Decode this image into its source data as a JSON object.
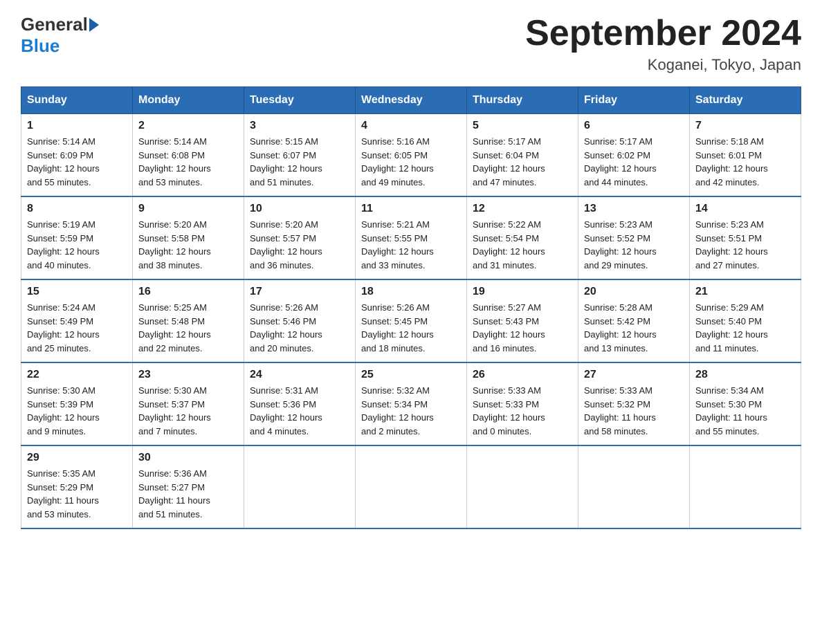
{
  "header": {
    "logo_general": "General",
    "logo_blue": "Blue",
    "title": "September 2024",
    "subtitle": "Koganei, Tokyo, Japan"
  },
  "days_of_week": [
    "Sunday",
    "Monday",
    "Tuesday",
    "Wednesday",
    "Thursday",
    "Friday",
    "Saturday"
  ],
  "weeks": [
    [
      {
        "day": "1",
        "sunrise": "5:14 AM",
        "sunset": "6:09 PM",
        "daylight": "12 hours and 55 minutes."
      },
      {
        "day": "2",
        "sunrise": "5:14 AM",
        "sunset": "6:08 PM",
        "daylight": "12 hours and 53 minutes."
      },
      {
        "day": "3",
        "sunrise": "5:15 AM",
        "sunset": "6:07 PM",
        "daylight": "12 hours and 51 minutes."
      },
      {
        "day": "4",
        "sunrise": "5:16 AM",
        "sunset": "6:05 PM",
        "daylight": "12 hours and 49 minutes."
      },
      {
        "day": "5",
        "sunrise": "5:17 AM",
        "sunset": "6:04 PM",
        "daylight": "12 hours and 47 minutes."
      },
      {
        "day": "6",
        "sunrise": "5:17 AM",
        "sunset": "6:02 PM",
        "daylight": "12 hours and 44 minutes."
      },
      {
        "day": "7",
        "sunrise": "5:18 AM",
        "sunset": "6:01 PM",
        "daylight": "12 hours and 42 minutes."
      }
    ],
    [
      {
        "day": "8",
        "sunrise": "5:19 AM",
        "sunset": "5:59 PM",
        "daylight": "12 hours and 40 minutes."
      },
      {
        "day": "9",
        "sunrise": "5:20 AM",
        "sunset": "5:58 PM",
        "daylight": "12 hours and 38 minutes."
      },
      {
        "day": "10",
        "sunrise": "5:20 AM",
        "sunset": "5:57 PM",
        "daylight": "12 hours and 36 minutes."
      },
      {
        "day": "11",
        "sunrise": "5:21 AM",
        "sunset": "5:55 PM",
        "daylight": "12 hours and 33 minutes."
      },
      {
        "day": "12",
        "sunrise": "5:22 AM",
        "sunset": "5:54 PM",
        "daylight": "12 hours and 31 minutes."
      },
      {
        "day": "13",
        "sunrise": "5:23 AM",
        "sunset": "5:52 PM",
        "daylight": "12 hours and 29 minutes."
      },
      {
        "day": "14",
        "sunrise": "5:23 AM",
        "sunset": "5:51 PM",
        "daylight": "12 hours and 27 minutes."
      }
    ],
    [
      {
        "day": "15",
        "sunrise": "5:24 AM",
        "sunset": "5:49 PM",
        "daylight": "12 hours and 25 minutes."
      },
      {
        "day": "16",
        "sunrise": "5:25 AM",
        "sunset": "5:48 PM",
        "daylight": "12 hours and 22 minutes."
      },
      {
        "day": "17",
        "sunrise": "5:26 AM",
        "sunset": "5:46 PM",
        "daylight": "12 hours and 20 minutes."
      },
      {
        "day": "18",
        "sunrise": "5:26 AM",
        "sunset": "5:45 PM",
        "daylight": "12 hours and 18 minutes."
      },
      {
        "day": "19",
        "sunrise": "5:27 AM",
        "sunset": "5:43 PM",
        "daylight": "12 hours and 16 minutes."
      },
      {
        "day": "20",
        "sunrise": "5:28 AM",
        "sunset": "5:42 PM",
        "daylight": "12 hours and 13 minutes."
      },
      {
        "day": "21",
        "sunrise": "5:29 AM",
        "sunset": "5:40 PM",
        "daylight": "12 hours and 11 minutes."
      }
    ],
    [
      {
        "day": "22",
        "sunrise": "5:30 AM",
        "sunset": "5:39 PM",
        "daylight": "12 hours and 9 minutes."
      },
      {
        "day": "23",
        "sunrise": "5:30 AM",
        "sunset": "5:37 PM",
        "daylight": "12 hours and 7 minutes."
      },
      {
        "day": "24",
        "sunrise": "5:31 AM",
        "sunset": "5:36 PM",
        "daylight": "12 hours and 4 minutes."
      },
      {
        "day": "25",
        "sunrise": "5:32 AM",
        "sunset": "5:34 PM",
        "daylight": "12 hours and 2 minutes."
      },
      {
        "day": "26",
        "sunrise": "5:33 AM",
        "sunset": "5:33 PM",
        "daylight": "12 hours and 0 minutes."
      },
      {
        "day": "27",
        "sunrise": "5:33 AM",
        "sunset": "5:32 PM",
        "daylight": "11 hours and 58 minutes."
      },
      {
        "day": "28",
        "sunrise": "5:34 AM",
        "sunset": "5:30 PM",
        "daylight": "11 hours and 55 minutes."
      }
    ],
    [
      {
        "day": "29",
        "sunrise": "5:35 AM",
        "sunset": "5:29 PM",
        "daylight": "11 hours and 53 minutes."
      },
      {
        "day": "30",
        "sunrise": "5:36 AM",
        "sunset": "5:27 PM",
        "daylight": "11 hours and 51 minutes."
      },
      null,
      null,
      null,
      null,
      null
    ]
  ],
  "labels": {
    "sunrise": "Sunrise:",
    "sunset": "Sunset:",
    "daylight": "Daylight:"
  }
}
